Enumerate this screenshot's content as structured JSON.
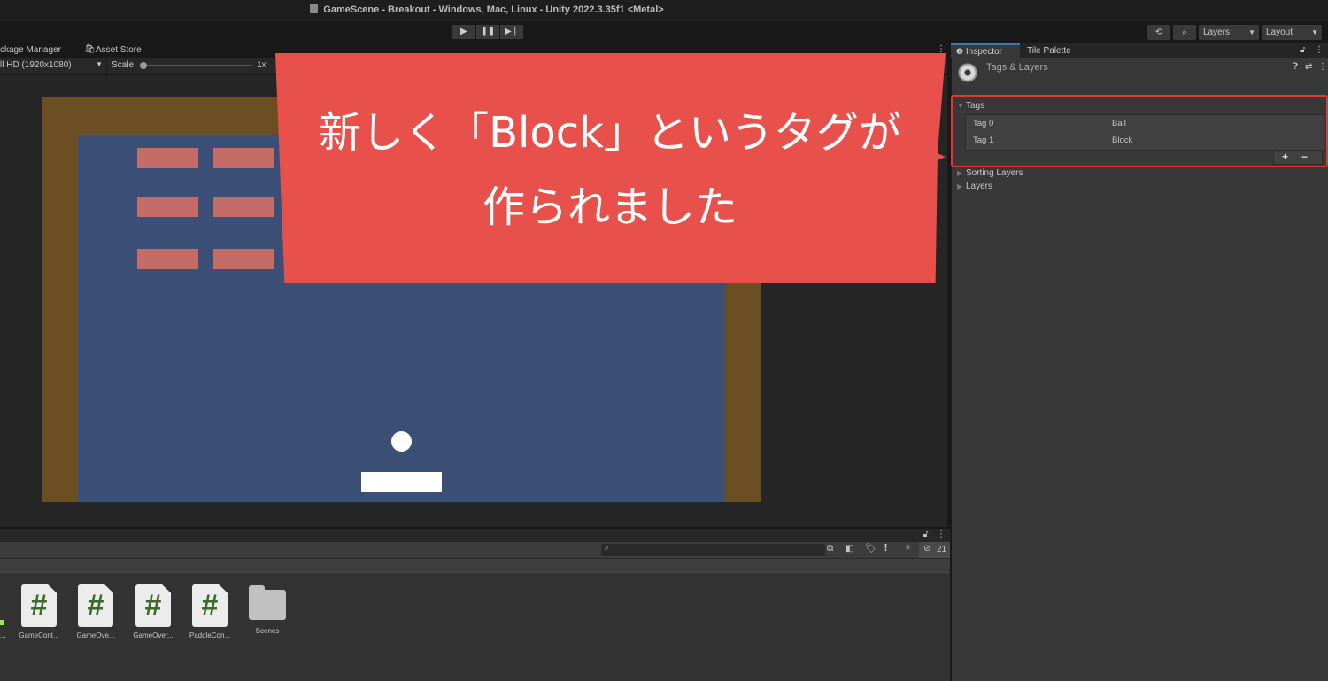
{
  "window": {
    "title": "GameScene - Breakout - Windows, Mac, Linux - Unity 2022.3.35f1 <Metal>"
  },
  "toolbar": {
    "play_icon": "play-icon",
    "pause_icon": "pause-icon",
    "step_icon": "step-icon",
    "history_icon": "history-icon",
    "search_icon": "search-icon",
    "layers_dropdown": "Layers",
    "layout_dropdown": "Layout"
  },
  "game_panel": {
    "tabs": [
      "ckage Manager",
      "Asset Store"
    ],
    "resolution": "ll HD (1920x1080)",
    "scale_label": "Scale",
    "scale_value": "1x",
    "scale_fraction": 0.0,
    "colors": {
      "wall": "#6b4e22",
      "field": "#3c4f76",
      "brick": "#c46c68",
      "ball": "#ffffff",
      "paddle": "#ffffff"
    }
  },
  "project_panel": {
    "search_placeholder": "",
    "hidden_count": "21",
    "assets": [
      {
        "name": "GameCont...",
        "type": "script"
      },
      {
        "name": "GameOve...",
        "type": "script"
      },
      {
        "name": "GameOver...",
        "type": "script"
      },
      {
        "name": "PaddleCon...",
        "type": "script"
      },
      {
        "name": "Scenes",
        "type": "folder"
      }
    ],
    "partial_asset_label": "..."
  },
  "inspector": {
    "tabs": [
      "Inspector",
      "Tile Palette"
    ],
    "header_title": "Tags & Layers",
    "sections": {
      "tags_label": "Tags",
      "tags": [
        {
          "name": "Tag 0",
          "value": "Ball"
        },
        {
          "name": "Tag 1",
          "value": "Block"
        }
      ],
      "add_label": "+",
      "remove_label": "−",
      "sorting_layers_label": "Sorting Layers",
      "layers_label": "Layers"
    },
    "highlight_color": "#e5352d"
  },
  "callout": {
    "line1": "新しく「Block」というタグが",
    "line2": "作られました",
    "color": "#e8514b"
  }
}
